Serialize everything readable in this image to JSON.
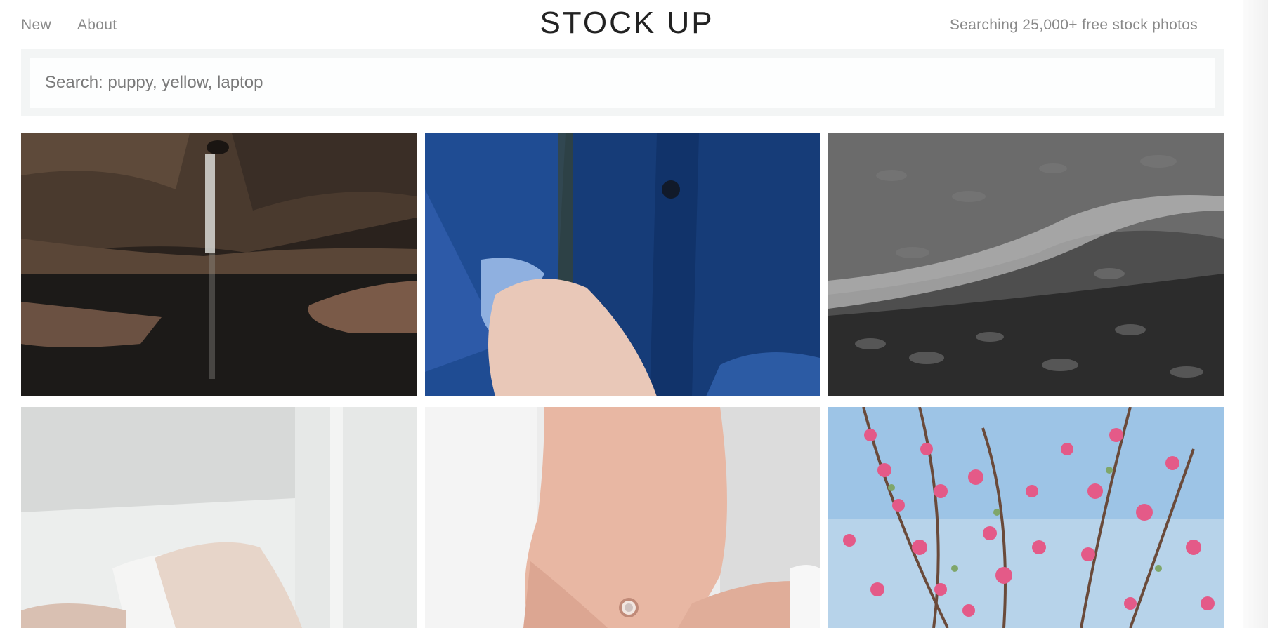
{
  "header": {
    "nav": [
      {
        "label": "New"
      },
      {
        "label": "About"
      }
    ],
    "logo": "STOCK UP",
    "tagline": "Searching 25,000+ free stock photos"
  },
  "search": {
    "placeholder": "Search: puppy, yellow, laptop",
    "value": ""
  },
  "photos": [
    {
      "subject": "waterfall-canyon"
    },
    {
      "subject": "man-in-blue-suit-hand"
    },
    {
      "subject": "black-white-water-texture"
    },
    {
      "subject": "white-bed-pillows"
    },
    {
      "subject": "hand-with-engagement-ring"
    },
    {
      "subject": "pink-blossom-branches"
    }
  ]
}
